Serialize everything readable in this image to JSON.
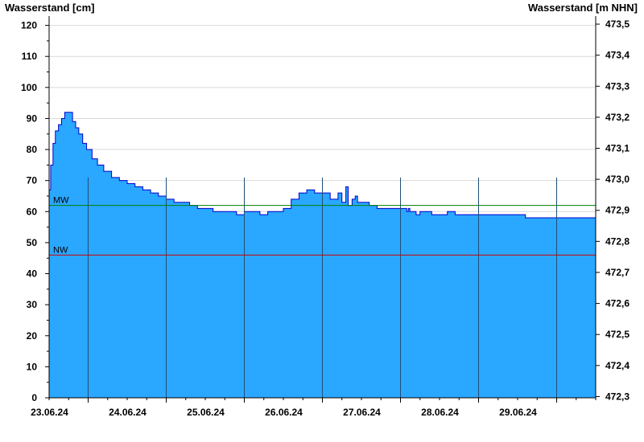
{
  "chart_data": {
    "type": "area",
    "ylabel_left": "Wasserstand [cm]",
    "ylabel_right": "Wasserstand [m NHN]",
    "ylim": [
      0,
      123
    ],
    "yticks_left": [
      0,
      10,
      20,
      30,
      40,
      50,
      60,
      70,
      80,
      90,
      100,
      110,
      120
    ],
    "yticks_right": [
      "472,3",
      "472,4",
      "472,5",
      "472,6",
      "472,7",
      "472,8",
      "472,9",
      "473,0",
      "473,1",
      "473,2",
      "473,3",
      "473,4",
      "473,5"
    ],
    "x_range_days": [
      22.5,
      29.5
    ],
    "x_labels": [
      "23.06.24",
      "24.06.24",
      "25.06.24",
      "26.06.24",
      "27.06.24",
      "28.06.24",
      "29.06.24"
    ],
    "day_boundaries": [
      23,
      24,
      25,
      26,
      27,
      28,
      29
    ],
    "reference_lines": [
      {
        "name": "MW",
        "value": 62,
        "color": "#008000"
      },
      {
        "name": "NW",
        "value": 46,
        "color": "#cc0000"
      }
    ],
    "series": [
      {
        "fill_color": "#2aa7ff",
        "line_color": "#0000cc",
        "x": [
          22.5,
          22.52,
          22.55,
          22.58,
          22.62,
          22.66,
          22.7,
          22.72,
          22.75,
          22.8,
          22.84,
          22.88,
          22.93,
          22.98,
          23.05,
          23.12,
          23.2,
          23.3,
          23.4,
          23.5,
          23.6,
          23.7,
          23.8,
          23.9,
          24.0,
          24.1,
          24.2,
          24.3,
          24.4,
          24.5,
          24.6,
          24.7,
          24.8,
          24.9,
          25.0,
          25.1,
          25.2,
          25.3,
          25.4,
          25.5,
          25.6,
          25.7,
          25.8,
          25.9,
          26.0,
          26.1,
          26.2,
          26.25,
          26.3,
          26.33,
          26.38,
          26.42,
          26.45,
          26.5,
          26.55,
          26.6,
          26.65,
          26.7,
          26.8,
          26.9,
          27.0,
          27.05,
          27.08,
          27.1,
          27.12,
          27.15,
          27.2,
          27.25,
          27.3,
          27.4,
          27.5,
          27.6,
          27.7,
          27.8,
          27.9,
          28.0,
          28.1,
          28.2,
          28.3,
          28.4,
          28.5,
          28.6,
          28.7,
          28.8,
          28.9,
          29.0,
          29.1,
          29.2,
          29.3,
          29.4,
          29.5
        ],
        "values": [
          67,
          75,
          82,
          86,
          88,
          90,
          92,
          92,
          92,
          89,
          87,
          85,
          82,
          80,
          77,
          75,
          73,
          71,
          70,
          69,
          68,
          67,
          66,
          65,
          64,
          63,
          63,
          62,
          61,
          61,
          60,
          60,
          60,
          59,
          60,
          60,
          59,
          60,
          60,
          61,
          64,
          66,
          67,
          66,
          66,
          64,
          66,
          63,
          68,
          62,
          64,
          65,
          63,
          63,
          63,
          62,
          62,
          61,
          61,
          61,
          61,
          61,
          60,
          61,
          60,
          60,
          59,
          60,
          60,
          59,
          59,
          60,
          59,
          59,
          59,
          59,
          59,
          59,
          59,
          59,
          59,
          58,
          58,
          58,
          58,
          58,
          58,
          58,
          58,
          58,
          58
        ]
      }
    ]
  }
}
